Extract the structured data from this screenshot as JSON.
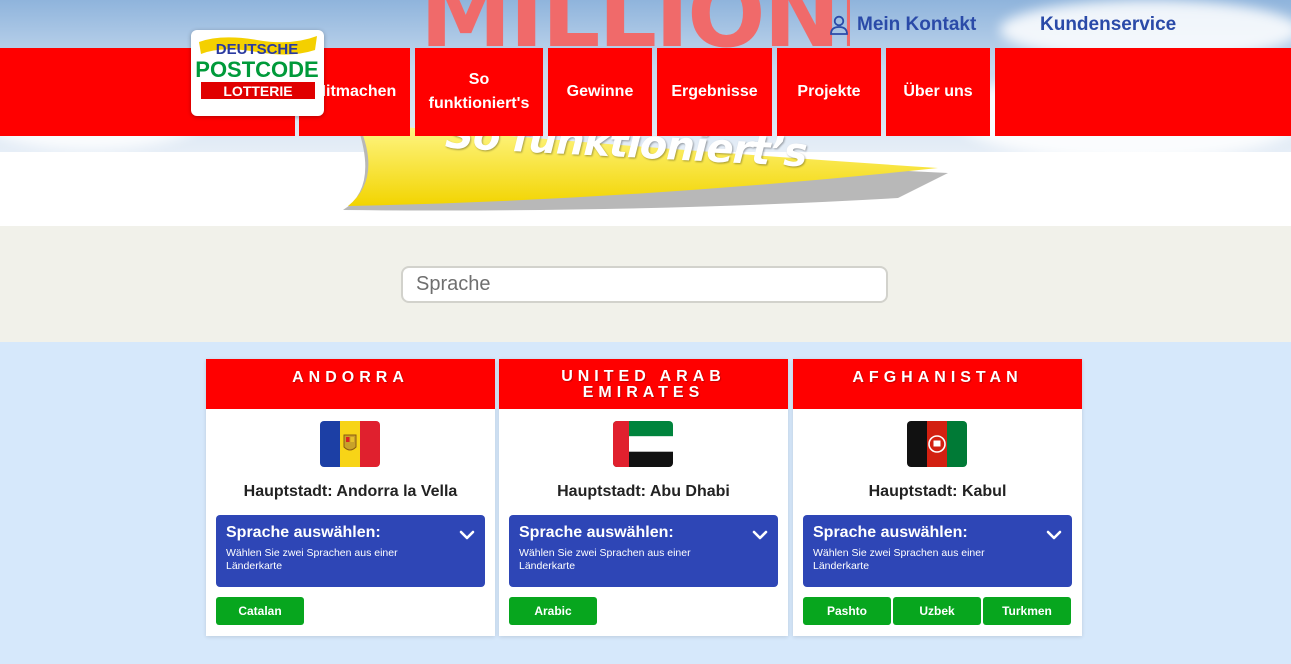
{
  "header": {
    "hero_word": "MILLIONEN",
    "banner_text": "So funktioniert’s",
    "top_links": {
      "contact": "Mein Kontakt",
      "service": "Kundenservice"
    },
    "logo": {
      "line1": "DEUTSCHE",
      "line2": "POSTCODE",
      "line3": "LOTTERIE"
    },
    "nav": [
      {
        "label": "Mitmachen"
      },
      {
        "label": "So funktioniert's"
      },
      {
        "label": "Gewinne"
      },
      {
        "label": "Ergebnisse"
      },
      {
        "label": "Projekte"
      },
      {
        "label": "Über uns"
      }
    ],
    "colors": {
      "nav_red": "#ff0000",
      "link_blue": "#2a4aa8"
    }
  },
  "search": {
    "placeholder": "Sprache",
    "value": ""
  },
  "cards": [
    {
      "country": "ANDORRA",
      "flag_icon": "andorra-flag-icon",
      "capital": "Hauptstadt: Andorra la Vella",
      "select_title": "Sprache auswählen:",
      "select_hint": "Wählen Sie zwei Sprachen aus einer Länderkarte",
      "languages": [
        "Catalan"
      ]
    },
    {
      "country": "UNITED ARAB EMIRATES",
      "flag_icon": "uae-flag-icon",
      "capital": "Hauptstadt: Abu Dhabi",
      "select_title": "Sprache auswählen:",
      "select_hint": "Wählen Sie zwei Sprachen aus einer Länderkarte",
      "languages": [
        "Arabic"
      ]
    },
    {
      "country": "AFGHANISTAN",
      "flag_icon": "afghanistan-flag-icon",
      "capital": "Hauptstadt: Kabul",
      "select_title": "Sprache auswählen:",
      "select_hint": "Wählen Sie zwei Sprachen aus einer Länderkarte",
      "languages": [
        "Pashto",
        "Uzbek",
        "Turkmen"
      ]
    }
  ],
  "theme": {
    "card_head": "#ff0000",
    "select_bg": "#2e46b6",
    "lang_btn": "#07a61e",
    "page_bg": "#d6e8fb"
  }
}
